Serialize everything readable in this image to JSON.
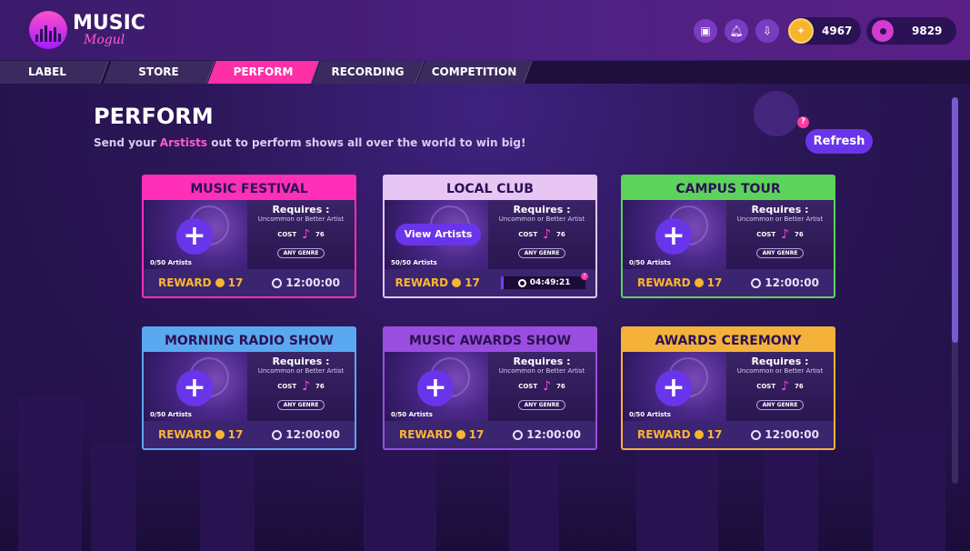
{
  "app": {
    "logo_title": "MUSIC",
    "logo_subtitle": "Mogul"
  },
  "topbar": {
    "icons": [
      "window-icon",
      "bell-icon",
      "inbox-icon"
    ],
    "coins": "4967",
    "fans": "9829"
  },
  "tabs": [
    {
      "label": "LABEL",
      "active": false
    },
    {
      "label": "STORE",
      "active": false
    },
    {
      "label": "PERFORM",
      "active": true
    },
    {
      "label": "RECORDING",
      "active": false
    },
    {
      "label": "COMPETITION",
      "active": false
    }
  ],
  "header": {
    "title": "PERFORM",
    "subtitle_pre": "Send your ",
    "subtitle_highlight": "Arstists",
    "subtitle_post": " out to perform shows all over the world to win big!",
    "refresh_label": "Refresh",
    "help_label": "?"
  },
  "cards": [
    {
      "title": "MUSIC FESTIVAL",
      "color": "#ff2fb8",
      "artists": "0/50 Artists",
      "requires": "Requires :",
      "requires_sub": "Uncommon or Better Artist",
      "cost_label": "COST",
      "cost": "76",
      "genre": "ANY GENRE",
      "reward_label": "REWARD",
      "reward": "17",
      "timer": "12:00:00"
    },
    {
      "title": "LOCAL CLUB",
      "color": "#e7c6f4",
      "artists": "50/50 Artists",
      "requires": "Requires :",
      "requires_sub": "Uncommon or Better Artist",
      "cost_label": "COST",
      "cost": "76",
      "genre": "ANY GENRE",
      "reward_label": "REWARD",
      "reward": "17",
      "timer": "04:49:21",
      "view_label": "View Artists"
    },
    {
      "title": "CAMPUS TOUR",
      "color": "#5cd35a",
      "artists": "0/50 Artists",
      "requires": "Requires :",
      "requires_sub": "Uncommon or Better Artist",
      "cost_label": "COST",
      "cost": "76",
      "genre": "ANY GENRE",
      "reward_label": "REWARD",
      "reward": "17",
      "timer": "12:00:00"
    },
    {
      "title": "MORNING RADIO SHOW",
      "color": "#5aa8f0",
      "artists": "0/50 Artists",
      "requires": "Requires :",
      "requires_sub": "Uncommon or Better Artist",
      "cost_label": "COST",
      "cost": "76",
      "genre": "ANY GENRE",
      "reward_label": "REWARD",
      "reward": "17",
      "timer": "12:00:00"
    },
    {
      "title": "MUSIC AWARDS SHOW",
      "color": "#9a4ee0",
      "artists": "0/50 Artists",
      "requires": "Requires :",
      "requires_sub": "Uncommon or Better Artist",
      "cost_label": "COST",
      "cost": "76",
      "genre": "ANY GENRE",
      "reward_label": "REWARD",
      "reward": "17",
      "timer": "12:00:00"
    },
    {
      "title": "AWARDS CEREMONY",
      "color": "#f4b23a",
      "artists": "0/50 Artists",
      "requires": "Requires :",
      "requires_sub": "Uncommon or Better Artist",
      "cost_label": "COST",
      "cost": "76",
      "genre": "ANY GENRE",
      "reward_label": "REWARD",
      "reward": "17",
      "timer": "12:00:00"
    }
  ]
}
